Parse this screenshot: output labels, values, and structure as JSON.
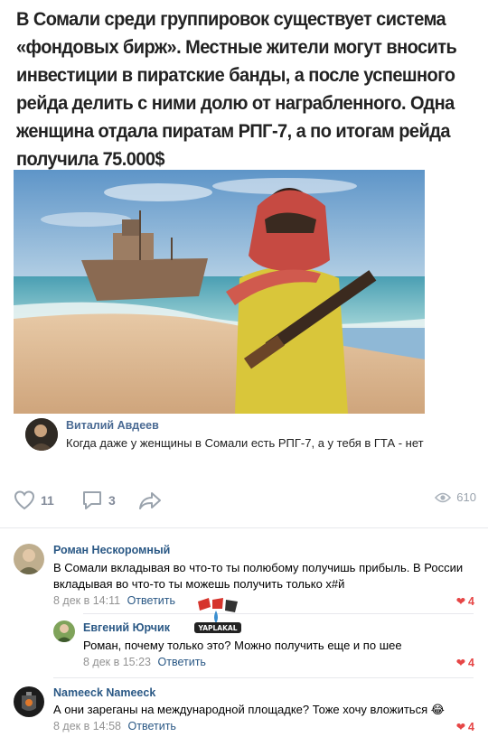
{
  "post": {
    "headline_lines": [
      "В Сомали среди группировок существует система",
      "«фондовых бирж». Местные жители могут вносить",
      "инвестиции в пиратские банды, а после успешного",
      "рейда делить с ними долю от награбленного. Одна",
      "женщина отдала пиратам РПГ-7, а по итогам рейда",
      "получила 75.000$"
    ],
    "quote": {
      "author": "Виталий Авдеев",
      "text": "Когда даже у женщины в Сомали есть РПГ-7, а у тебя в ГТА - нет"
    },
    "actions": {
      "likes": "11",
      "comments": "3",
      "views": "610"
    }
  },
  "comments": [
    {
      "author": "Роман Нескоромный",
      "text": "В Сомали вкладывая во что-то ты полюбому получишь прибыль. В России вкладывая во что-то ты можешь получить только х#й",
      "date": "8 дек в 14:11",
      "reply_label": "Ответить",
      "likes": "4"
    },
    {
      "author": "Евгений Юрчик",
      "text": "Роман, почему только это? Можно получить еще и по шее",
      "date": "8 дек в 15:23",
      "reply_label": "Ответить",
      "likes": "4"
    },
    {
      "author": "Nameeck Nameeck",
      "text": "А они зареганы на международной площадке? Тоже хочу вложиться 😂",
      "date": "8 дек в 14:58",
      "reply_label": "Ответить",
      "likes": "4"
    }
  ],
  "watermark": "YAPLAKAL",
  "colors": {
    "link": "#2a5885",
    "like_red": "#e64646",
    "muted": "#828a99"
  }
}
